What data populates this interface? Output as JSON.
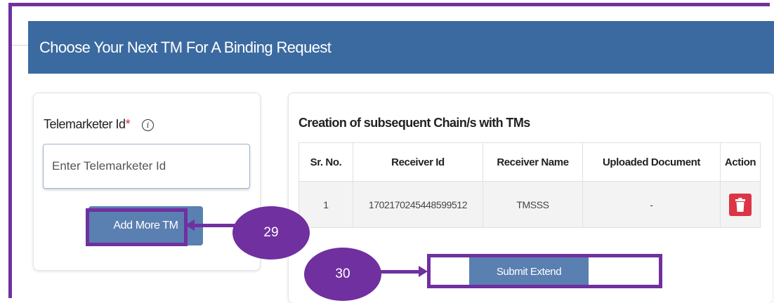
{
  "header": {
    "title": "Choose Your Next TM For A Binding Request"
  },
  "form": {
    "label": "Telemarketer Id",
    "required_mark": "*",
    "info_icon": "info-icon",
    "input_placeholder": "Enter Telemarketer Id",
    "input_value": "",
    "add_button": "Add More TM"
  },
  "chain": {
    "title": "Creation of subsequent Chain/s with TMs",
    "columns": [
      "Sr. No.",
      "Receiver Id",
      "Receiver Name",
      "Uploaded Document",
      "Action"
    ],
    "rows": [
      {
        "sr": "1",
        "receiver_id": "1702170245448599512",
        "receiver_name": "TMSSS",
        "document": "-",
        "action_icon": "trash-icon"
      }
    ],
    "submit_button": "Submit Extend"
  },
  "callouts": [
    {
      "number": "29"
    },
    {
      "number": "30"
    }
  ],
  "colors": {
    "header_bg": "#3b6aa0",
    "button_bg": "#5a7fb1",
    "annotation": "#7030a0",
    "delete_bg": "#dc3545",
    "required": "#d32f2f"
  }
}
